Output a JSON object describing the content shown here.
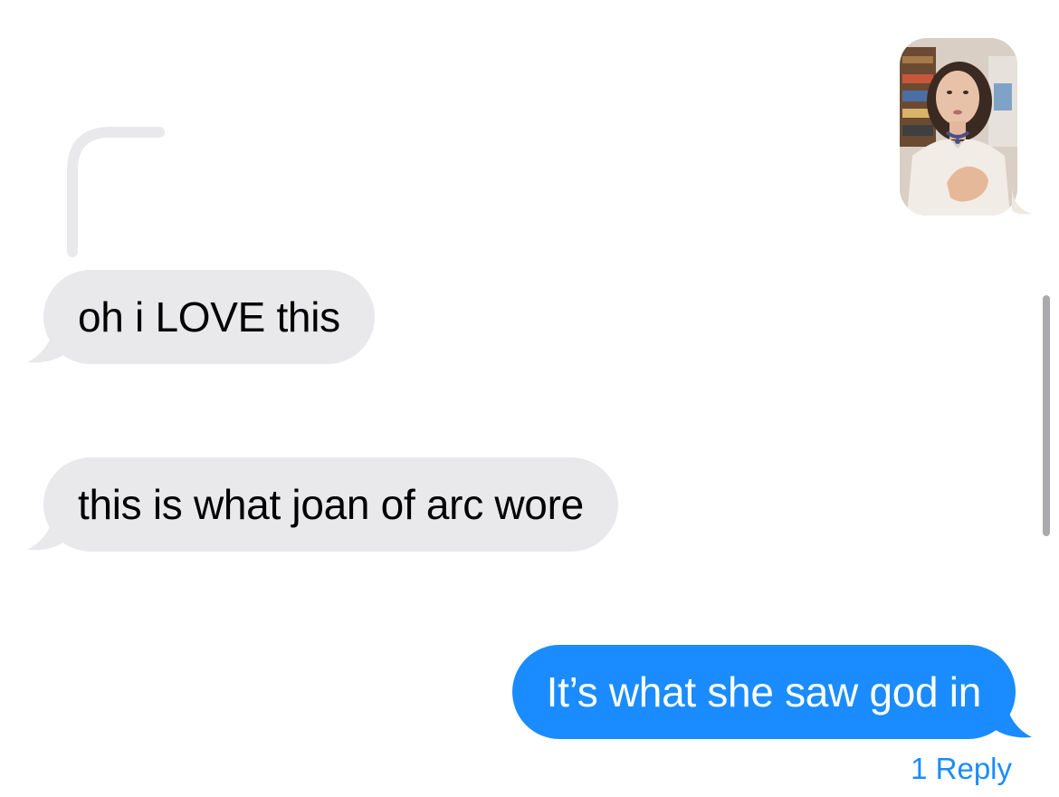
{
  "conversation": {
    "sent_photo": {
      "description_icon": "photo-thumbnail-icon"
    },
    "messages": [
      {
        "direction": "incoming",
        "text": "oh i LOVE this"
      },
      {
        "direction": "incoming",
        "text": "this is what joan of arc wore"
      },
      {
        "direction": "outgoing",
        "text": "It’s what she saw god in"
      }
    ],
    "reply_link": "1 Reply"
  },
  "colors": {
    "incoming_bubble": "#e9e9eb",
    "outgoing_bubble": "#1a8cff",
    "reply_link": "#1a8cff",
    "thread_line": "#e9e9eb"
  }
}
